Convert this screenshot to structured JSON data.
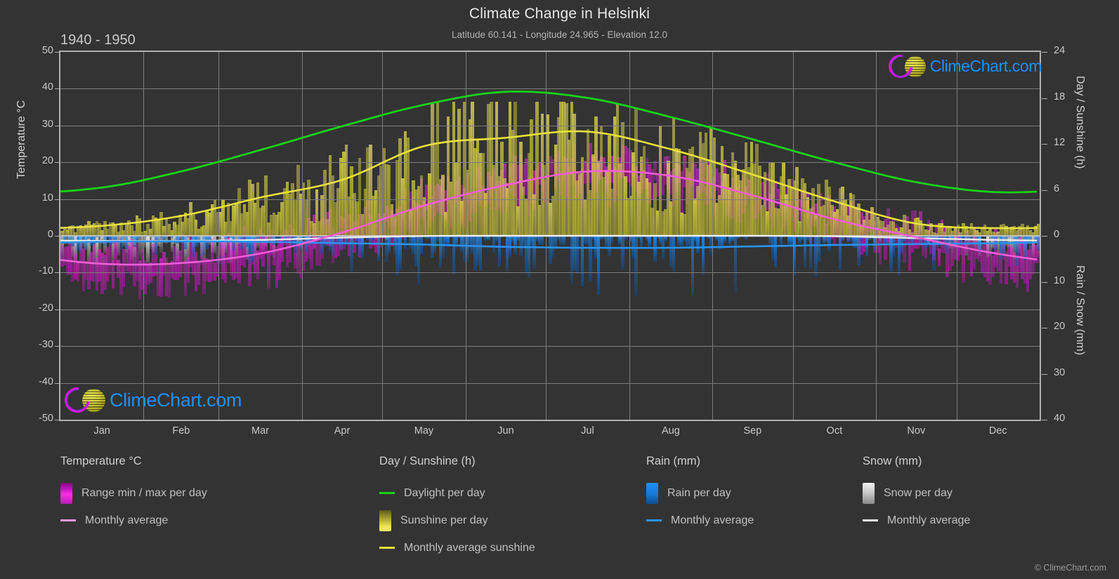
{
  "header": {
    "title": "Climate Change in Helsinki",
    "subtitle": "Latitude 60.141 - Longitude 24.965 - Elevation 12.0",
    "period": "1940 - 1950",
    "logo_text": "ClimeChart.com",
    "copyright": "© ClimeChart.com"
  },
  "axes": {
    "left_label": "Temperature °C",
    "right_top_label": "Day / Sunshine (h)",
    "right_bottom_label": "Rain / Snow (mm)",
    "left_ticks": [
      "50",
      "40",
      "30",
      "20",
      "10",
      "0",
      "-10",
      "-20",
      "-30",
      "-40",
      "-50"
    ],
    "right_ticks": [
      "24",
      "18",
      "12",
      "6",
      "0",
      "10",
      "20",
      "30",
      "40"
    ],
    "x_ticks": [
      "Jan",
      "Feb",
      "Mar",
      "Apr",
      "May",
      "Jun",
      "Jul",
      "Aug",
      "Sep",
      "Oct",
      "Nov",
      "Dec"
    ]
  },
  "legend": {
    "groups": [
      {
        "title": "Temperature °C",
        "items": [
          {
            "label": "Range min / max per day",
            "marker": "box",
            "style": "sw-range"
          },
          {
            "label": "Monthly average",
            "marker": "line",
            "style": "ln-temp"
          }
        ]
      },
      {
        "title": "Day / Sunshine (h)",
        "items": [
          {
            "label": "Daylight per day",
            "marker": "line",
            "style": "ln-day"
          },
          {
            "label": "Sunshine per day",
            "marker": "box",
            "style": "sw-sun"
          },
          {
            "label": "Monthly average sunshine",
            "marker": "line",
            "style": "ln-sunavg"
          }
        ]
      },
      {
        "title": "Rain (mm)",
        "items": [
          {
            "label": "Rain per day",
            "marker": "box",
            "style": "sw-rain"
          },
          {
            "label": "Monthly average",
            "marker": "line",
            "style": "ln-rain"
          }
        ]
      },
      {
        "title": "Snow (mm)",
        "items": [
          {
            "label": "Snow per day",
            "marker": "box",
            "style": "sw-snow"
          },
          {
            "label": "Monthly average",
            "marker": "line",
            "style": "ln-snow"
          }
        ]
      }
    ]
  },
  "colors": {
    "background": "#333333",
    "grid": "#7d7d7d",
    "frame": "#b0b0b0",
    "daylight": "#19d219",
    "sunshine_avg": "#e8e23c",
    "sunshine_bar": "#cfc840",
    "temp_avg": "#f45ed8",
    "temp_range": "#d41ad4",
    "rain": "#1e90ff",
    "rain_avg": "#2b93f0",
    "snow": "#d0d0d0",
    "snow_avg": "#ededed",
    "text": "#c8c8c8",
    "logo_blue": "#1e90ff",
    "logo_magenta": "#e013e0",
    "logo_yellow": "#ded93f"
  },
  "chart_data": {
    "type": "line",
    "title": "Climate Change in Helsinki",
    "subtitle": "Latitude 60.141 - Longitude 24.965 - Elevation 12.0",
    "xlabel": "",
    "ylabel": "Temperature °C",
    "ylim": [
      -50,
      50
    ],
    "y2lim_top": [
      0,
      24
    ],
    "y2lim_bottom": [
      0,
      40
    ],
    "grid": true,
    "legend_position": "bottom",
    "categories": [
      "Jan",
      "Feb",
      "Mar",
      "Apr",
      "May",
      "Jun",
      "Jul",
      "Aug",
      "Sep",
      "Oct",
      "Nov",
      "Dec"
    ],
    "series": [
      {
        "name": "Daylight per day",
        "unit": "h",
        "axis": "right-top",
        "values": [
          6.3,
          8.4,
          11.2,
          14.3,
          17.1,
          18.8,
          18.0,
          15.5,
          12.6,
          9.6,
          7.0,
          5.7
        ]
      },
      {
        "name": "Monthly average sunshine",
        "unit": "h",
        "axis": "right-top",
        "values": [
          1.3,
          2.6,
          5.0,
          7.3,
          11.7,
          12.8,
          13.6,
          11.3,
          8.0,
          4.5,
          1.6,
          1.0
        ]
      },
      {
        "name": "Temperature monthly average",
        "unit": "°C",
        "axis": "left",
        "values": [
          -7.6,
          -7.4,
          -4.8,
          0.9,
          8.2,
          13.8,
          17.5,
          16.3,
          11.0,
          4.5,
          -0.4,
          -4.9
        ]
      },
      {
        "name": "Rain monthly average",
        "unit": "mm",
        "axis": "right-bottom",
        "values": [
          1.3,
          1.2,
          1.3,
          1.6,
          1.9,
          2.4,
          2.6,
          2.6,
          2.3,
          2.0,
          1.8,
          1.6
        ]
      },
      {
        "name": "Snow monthly average",
        "unit": "mm",
        "axis": "right-bottom",
        "values": [
          1.1,
          1.1,
          0.9,
          0.4,
          0.05,
          0.0,
          0.0,
          0.0,
          0.0,
          0.1,
          0.5,
          0.9
        ]
      }
    ],
    "daily_ranges_note": "Daily min/max temperature range bars, daily sunshine bars, daily rain bars and daily snow bars are drawn per day across the year."
  }
}
